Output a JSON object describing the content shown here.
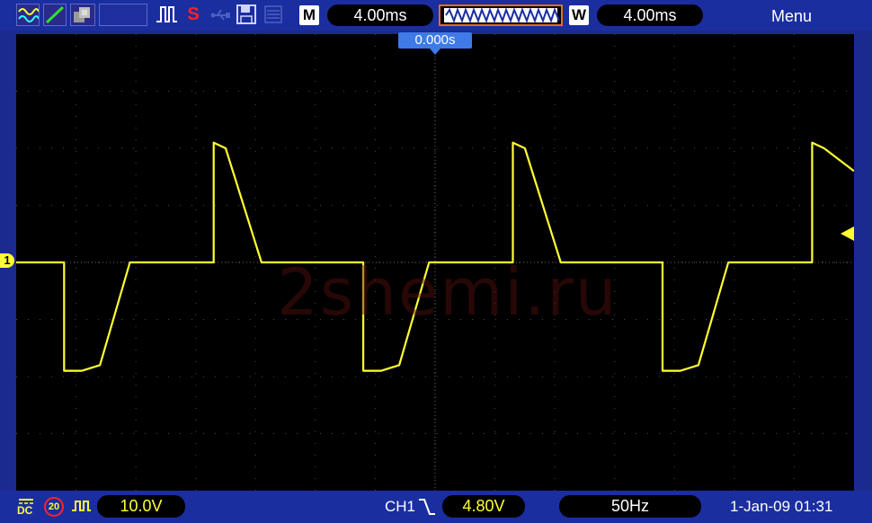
{
  "toolbar": {
    "icons": [
      "waveform-icon",
      "ramp-icon",
      "persistence-icon",
      "blank-display",
      "pulse-icon",
      "save-s-icon",
      "usb-icon",
      "floppy-disk-icon",
      "memory-icon"
    ],
    "save_letter": "S",
    "main_label": "M",
    "main_timebase": "4.00ms",
    "window_label": "W",
    "window_timebase": "4.00ms",
    "menu": "Menu"
  },
  "trigger": {
    "time_offset": "0.000s",
    "level_marker": "trigger-level"
  },
  "channel": {
    "id": "1",
    "coupling": "DC",
    "bw_limit": "20",
    "scale": "10.0V",
    "color": "#ffff33"
  },
  "status": {
    "source": "CH1",
    "slope": "falling",
    "trigger_level": "4.80V",
    "frequency": "50Hz",
    "datetime": "1-Jan-09 01:31"
  },
  "watermark": "2shemi.ru",
  "colors": {
    "frame": "#1b2ea0",
    "trace": "#ffff33",
    "grid": "#4a4a4a",
    "trigger_label": "#3f7ae8"
  },
  "chart_data": {
    "type": "line",
    "x_unit": "div",
    "y_unit": "div",
    "xlim": [
      -7.0,
      7.0
    ],
    "ylim": [
      -4.0,
      4.0
    ],
    "grid": true,
    "period_div": 5.0,
    "series": [
      {
        "values_description_free": true,
        "x": [
          -7.0,
          -6.2,
          -6.2,
          -5.9,
          -5.6,
          -5.1,
          -4.4,
          -3.7,
          -3.7,
          -3.5,
          -2.9,
          -2.0,
          -1.2,
          -1.2,
          -0.9,
          -0.6,
          -0.1,
          0.6,
          1.3,
          1.3,
          1.5,
          2.1,
          3.0,
          3.8,
          3.8,
          4.1,
          4.4,
          4.9,
          5.6,
          6.3,
          6.3,
          6.5,
          7.0
        ],
        "y": [
          0.0,
          0.0,
          -1.9,
          -1.9,
          -1.8,
          0.0,
          0.0,
          0.0,
          2.1,
          2.0,
          0.0,
          0.0,
          0.0,
          -1.9,
          -1.9,
          -1.8,
          0.0,
          0.0,
          0.0,
          2.1,
          2.0,
          0.0,
          0.0,
          0.0,
          -1.9,
          -1.9,
          -1.8,
          0.0,
          0.0,
          0.0,
          2.1,
          2.0,
          1.6
        ]
      }
    ]
  }
}
